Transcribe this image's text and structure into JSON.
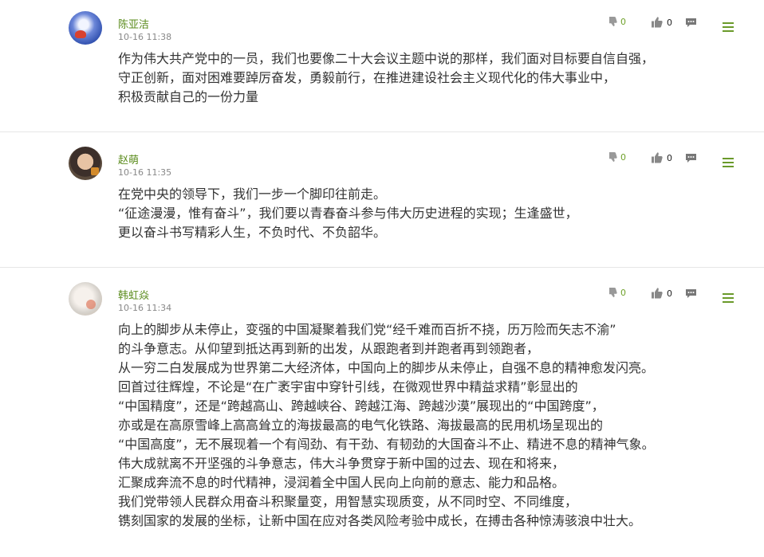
{
  "comments": [
    {
      "user": "陈亚洁",
      "time": "10-16 11:38",
      "dislikes": "0",
      "likes": "0",
      "lines": [
        "作为伟大共产党中的一员，我们也要像二十大会议主题中说的那样，我们面对目标要自信自强，",
        "守正创新，面对困难要踔厉奋发，勇毅前行，在推进建设社会主义现代化的伟大事业中，",
        "积极贡献自己的一份力量"
      ]
    },
    {
      "user": "赵萌",
      "time": "10-16 11:35",
      "dislikes": "0",
      "likes": "0",
      "lines": [
        "在党中央的领导下，我们一步一个脚印往前走。",
        "“征途漫漫，惟有奋斗”，我们要以青春奋斗参与伟大历史进程的实现；生逢盛世，",
        "更以奋斗书写精彩人生，不负时代、不负韶华。"
      ]
    },
    {
      "user": "韩虹焱",
      "time": "10-16 11:34",
      "dislikes": "0",
      "likes": "0",
      "lines": [
        "向上的脚步从未停止，变强的中国凝聚着我们党“经千难而百折不挠，历万险而矢志不渝”",
        "的斗争意志。从仰望到抵达再到新的出发，从跟跑者到并跑者再到领跑者，",
        "从一穷二白发展成为世界第二大经济体，中国向上的脚步从未停止，自强不息的精神愈发闪亮。",
        "回首过往辉煌，不论是“在广袤宇宙中穿针引线，在微观世界中精益求精”彰显出的",
        "“中国精度”，还是“跨越高山、跨越峡谷、跨越江海、跨越沙漠”展现出的“中国跨度”，",
        "亦或是在高原雪峰上高高耸立的海拔最高的电气化铁路、海拔最高的民用机场呈现出的",
        "“中国高度”，无不展现着一个有闯劲、有干劲、有韧劲的大国奋斗不止、精进不息的精神气象。",
        "伟大成就离不开坚强的斗争意志，伟大斗争贯穿于新中国的过去、现在和将来，",
        "汇聚成奔流不息的时代精神，浸润着全中国人民向上向前的意志、能力和品格。",
        "我们党带领人民群众用奋斗积聚量变，用智慧实现质变，从不同时空、不同维度，",
        "镌刻国家的发展的坐标，让新中国在应对各类风险考验中成长，在搏击各种惊涛骇浪中壮大。"
      ]
    }
  ],
  "icons": {
    "dislike": "thumbs-down-icon",
    "like": "thumbs-up-icon",
    "reply": "reply-icon",
    "menu": "menu-icon"
  },
  "colors": {
    "username": "#5b8c1d",
    "accent": "#6a9a2a"
  }
}
